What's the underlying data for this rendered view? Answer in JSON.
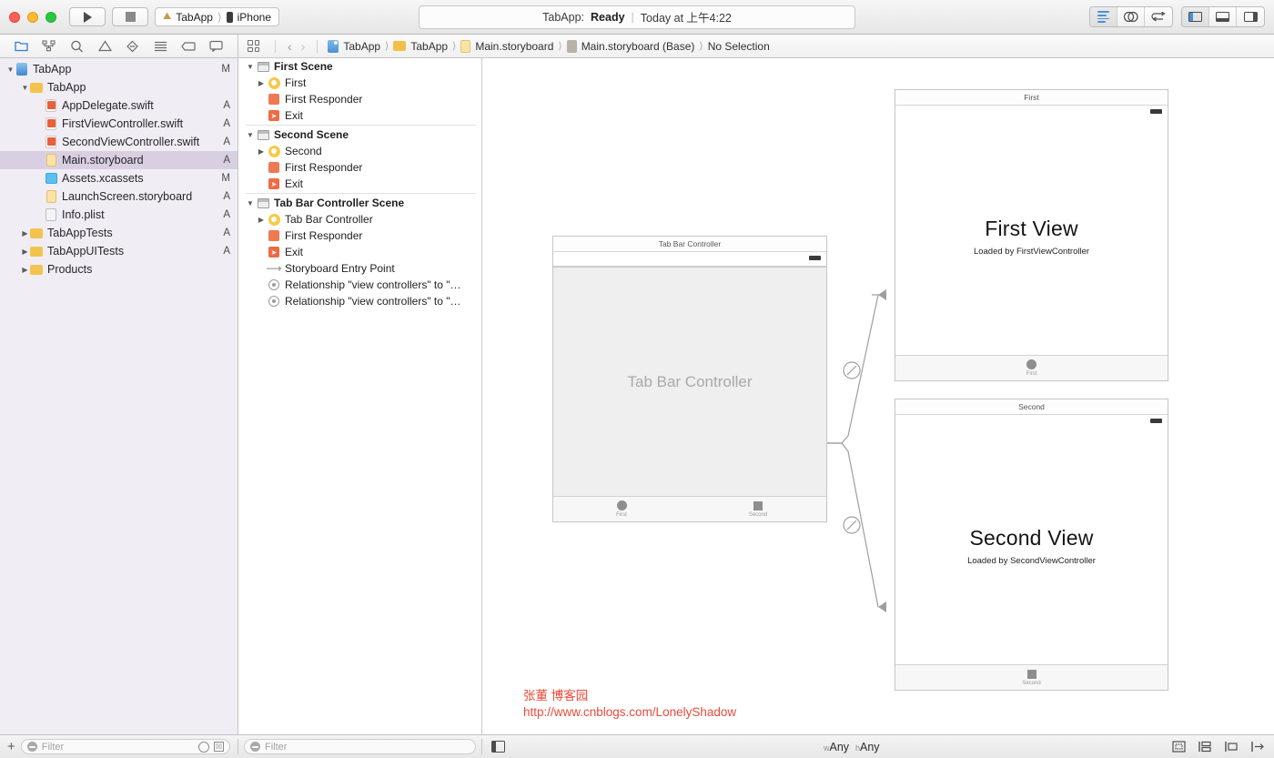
{
  "window": {
    "traffic_lights": [
      "close",
      "minimize",
      "zoom"
    ],
    "run_button": "run-icon",
    "stop_button": "stop-icon",
    "scheme": {
      "name": "TabApp",
      "destination": "iPhone"
    },
    "status": {
      "prefix": "TabApp:",
      "state": "Ready",
      "separator": "|",
      "time": "Today at 上午4:22"
    },
    "editor_modes": [
      "standard-editor",
      "assistant-editor",
      "version-editor"
    ],
    "view_toggles": [
      "navigator-toggle",
      "debug-area-toggle",
      "utilities-toggle"
    ]
  },
  "navigator_tabs": [
    {
      "name": "project-navigator",
      "icon": "folder-icon",
      "active": true
    },
    {
      "name": "source-control-navigator",
      "icon": "source-control-icon",
      "active": false
    },
    {
      "name": "symbol-navigator",
      "icon": "search-icon",
      "active": false
    },
    {
      "name": "issue-navigator",
      "icon": "warning-triangle-icon",
      "active": false
    },
    {
      "name": "test-navigator",
      "icon": "diamond-icon",
      "active": false
    },
    {
      "name": "debug-navigator",
      "icon": "list-icon",
      "active": false
    },
    {
      "name": "breakpoint-navigator",
      "icon": "tag-icon",
      "active": false
    },
    {
      "name": "report-navigator",
      "icon": "speech-bubble-icon",
      "active": false
    }
  ],
  "jump_bar": {
    "related_items": "grid-icon",
    "back": "‹",
    "forward": "›",
    "crumbs": [
      {
        "label": "TabApp",
        "icon": "project-icon"
      },
      {
        "label": "TabApp",
        "icon": "folder-icon"
      },
      {
        "label": "Main.storyboard",
        "icon": "storyboard-icon"
      },
      {
        "label": "Main.storyboard (Base)",
        "icon": "document-icon"
      },
      {
        "label": "No Selection",
        "icon": "none"
      }
    ]
  },
  "project_navigator": {
    "items": [
      {
        "label": "TabApp",
        "icon": "project-icon",
        "indent": 0,
        "twisty": "down",
        "status": "M",
        "selected": false
      },
      {
        "label": "TabApp",
        "icon": "folder-icon",
        "indent": 1,
        "twisty": "down",
        "status": "",
        "selected": false
      },
      {
        "label": "AppDelegate.swift",
        "icon": "swift-icon",
        "indent": 2,
        "twisty": "",
        "status": "A",
        "selected": false
      },
      {
        "label": "FirstViewController.swift",
        "icon": "swift-icon",
        "indent": 2,
        "twisty": "",
        "status": "A",
        "selected": false
      },
      {
        "label": "SecondViewController.swift",
        "icon": "swift-icon",
        "indent": 2,
        "twisty": "",
        "status": "A",
        "selected": false
      },
      {
        "label": "Main.storyboard",
        "icon": "storyboard-icon",
        "indent": 2,
        "twisty": "",
        "status": "A",
        "selected": true
      },
      {
        "label": "Assets.xcassets",
        "icon": "assets-icon",
        "indent": 2,
        "twisty": "",
        "status": "M",
        "selected": false
      },
      {
        "label": "LaunchScreen.storyboard",
        "icon": "storyboard-icon",
        "indent": 2,
        "twisty": "",
        "status": "A",
        "selected": false
      },
      {
        "label": "Info.plist",
        "icon": "plist-icon",
        "indent": 2,
        "twisty": "",
        "status": "A",
        "selected": false
      },
      {
        "label": "TabAppTests",
        "icon": "folder-icon",
        "indent": 1,
        "twisty": "right",
        "status": "A",
        "selected": false
      },
      {
        "label": "TabAppUITests",
        "icon": "folder-icon",
        "indent": 1,
        "twisty": "right",
        "status": "A",
        "selected": false
      },
      {
        "label": "Products",
        "icon": "folder-icon",
        "indent": 1,
        "twisty": "right",
        "status": "",
        "selected": false
      }
    ]
  },
  "document_outline": {
    "groups": [
      {
        "header": {
          "label": "First Scene",
          "icon": "scene-icon",
          "twisty": "down"
        },
        "items": [
          {
            "label": "First",
            "icon": "view-controller-icon",
            "twisty": "right"
          },
          {
            "label": "First Responder",
            "icon": "first-responder-icon",
            "twisty": ""
          },
          {
            "label": "Exit",
            "icon": "exit-icon",
            "twisty": ""
          }
        ]
      },
      {
        "header": {
          "label": "Second Scene",
          "icon": "scene-icon",
          "twisty": "down"
        },
        "items": [
          {
            "label": "Second",
            "icon": "view-controller-icon",
            "twisty": "right"
          },
          {
            "label": "First Responder",
            "icon": "first-responder-icon",
            "twisty": ""
          },
          {
            "label": "Exit",
            "icon": "exit-icon",
            "twisty": ""
          }
        ]
      },
      {
        "header": {
          "label": "Tab Bar Controller Scene",
          "icon": "scene-icon",
          "twisty": "down"
        },
        "items": [
          {
            "label": "Tab Bar Controller",
            "icon": "view-controller-icon",
            "twisty": "right"
          },
          {
            "label": "First Responder",
            "icon": "first-responder-icon",
            "twisty": ""
          },
          {
            "label": "Exit",
            "icon": "exit-icon",
            "twisty": ""
          },
          {
            "label": "Storyboard Entry Point",
            "icon": "entry-point-icon",
            "twisty": ""
          },
          {
            "label": "Relationship \"view controllers\" to \"…",
            "icon": "relationship-icon",
            "twisty": ""
          },
          {
            "label": "Relationship \"view controllers\" to \"…",
            "icon": "relationship-icon",
            "twisty": ""
          }
        ]
      }
    ]
  },
  "canvas": {
    "scenes": {
      "tab_bar_controller": {
        "title": "Tab Bar Controller",
        "placeholder": "Tab Bar Controller",
        "tabs": [
          {
            "label": "First",
            "icon": "circle-icon"
          },
          {
            "label": "Second",
            "icon": "square-icon"
          }
        ]
      },
      "first_view": {
        "title": "First",
        "heading": "First View",
        "subtitle": "Loaded by FirstViewController",
        "tabs": [
          {
            "label": "First",
            "icon": "circle-icon"
          }
        ]
      },
      "second_view": {
        "title": "Second",
        "heading": "Second View",
        "subtitle": "Loaded by SecondViewController",
        "tabs": [
          {
            "label": "Second",
            "icon": "square-icon"
          }
        ]
      }
    },
    "watermark": {
      "line1": "张董 博客园",
      "line2": "http://www.cnblogs.com/LonelyShadow",
      "color": "#ec4a3a"
    }
  },
  "bottom_bar": {
    "add_button": "+",
    "navigator_filter_placeholder": "Filter",
    "navigator_filter_value": "",
    "outline_filter_placeholder": "Filter",
    "outline_filter_value": "",
    "document_outline_toggle": "document-outline-icon",
    "size_class": {
      "w_prefix": "w",
      "w_value": "Any",
      "h_prefix": "h",
      "h_value": "Any"
    },
    "autolayout_buttons": [
      "update-frames-icon",
      "embed-in-icon",
      "align-icon",
      "pin-icon",
      "resolve-issues-icon"
    ]
  }
}
